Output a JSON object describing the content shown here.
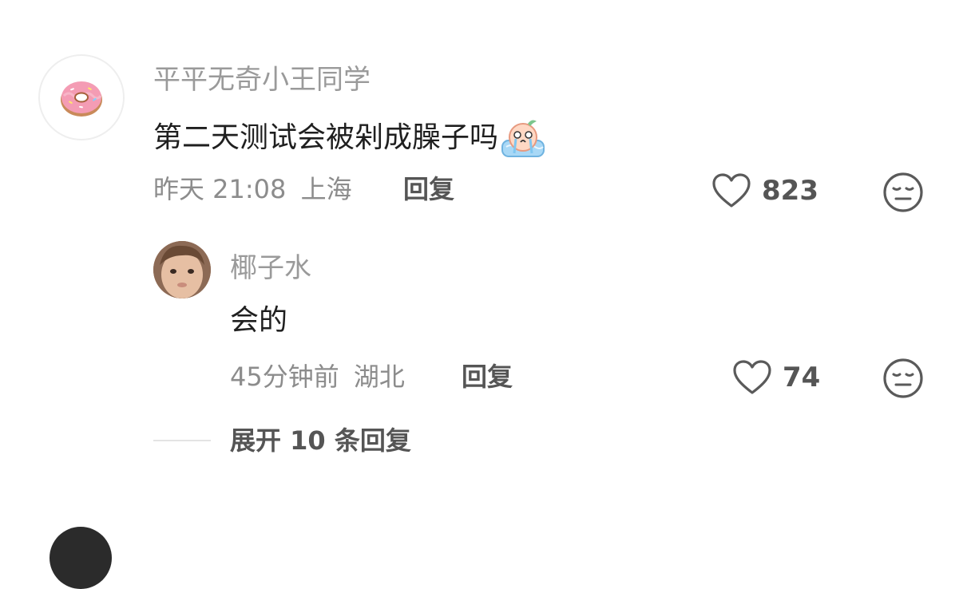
{
  "comment": {
    "username": "平平无奇小王同学",
    "text": "第二天测试会被剁成臊子吗",
    "time": "昨天 21:08",
    "location": "上海",
    "reply_label": "回复",
    "like_count": "823",
    "avatar_icon": "donut-icon",
    "emoji_icon": "crying-emoji-icon"
  },
  "reply": {
    "username": "椰子水",
    "text": "会的",
    "time": "45分钟前",
    "location": "湖北",
    "reply_label": "回复",
    "like_count": "74",
    "avatar_icon": "child-face-avatar"
  },
  "expand": {
    "label": "展开 10 条回复"
  },
  "icons": {
    "like": "heart-outline-icon",
    "dislike": "meh-face-icon"
  }
}
